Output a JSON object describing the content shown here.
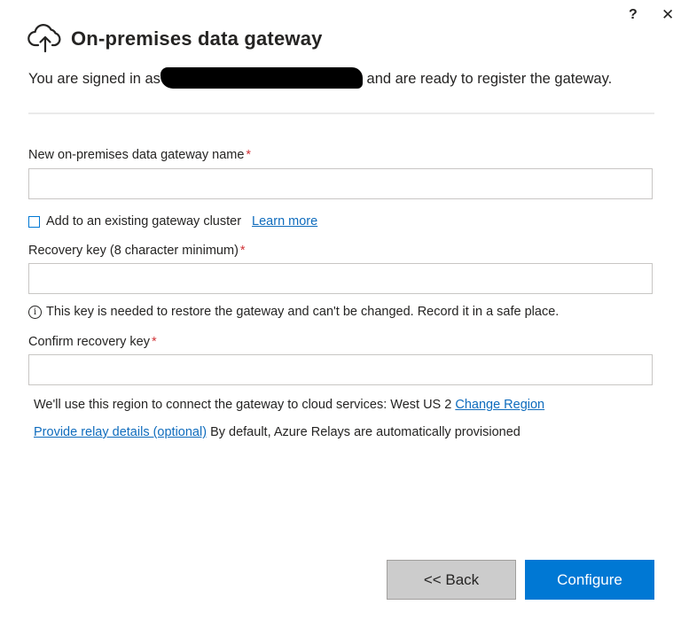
{
  "window": {
    "help_label": "?",
    "close_label": "✕"
  },
  "header": {
    "title": "On-premises data gateway",
    "icon": "cloud-upload-icon"
  },
  "signed_in": {
    "prefix": "You are signed in as",
    "suffix": "and are ready to register the gateway."
  },
  "form": {
    "gateway_name_label": "New on-premises data gateway name",
    "gateway_name_value": "",
    "required_marker": "*",
    "cluster_checkbox_label": "Add to an existing gateway cluster",
    "cluster_checkbox_checked": false,
    "learn_more_link": "Learn more",
    "recovery_key_label": "Recovery key (8 character minimum)",
    "recovery_key_value": "",
    "recovery_info": "This key is needed to restore the gateway and can't be changed. Record it in a safe place.",
    "info_icon": "i",
    "confirm_key_label": "Confirm recovery key",
    "confirm_key_value": ""
  },
  "region": {
    "text": "We'll use this region to connect the gateway to cloud services: West US 2",
    "change_link": "Change Region"
  },
  "relay": {
    "link": "Provide relay details (optional)",
    "text": "By default, Azure Relays are automatically provisioned"
  },
  "buttons": {
    "back": "<< Back",
    "configure": "Configure"
  },
  "colors": {
    "accent": "#0078d4",
    "link": "#0f6cbd",
    "required": "#d13438",
    "back_button": "#cccccc"
  }
}
